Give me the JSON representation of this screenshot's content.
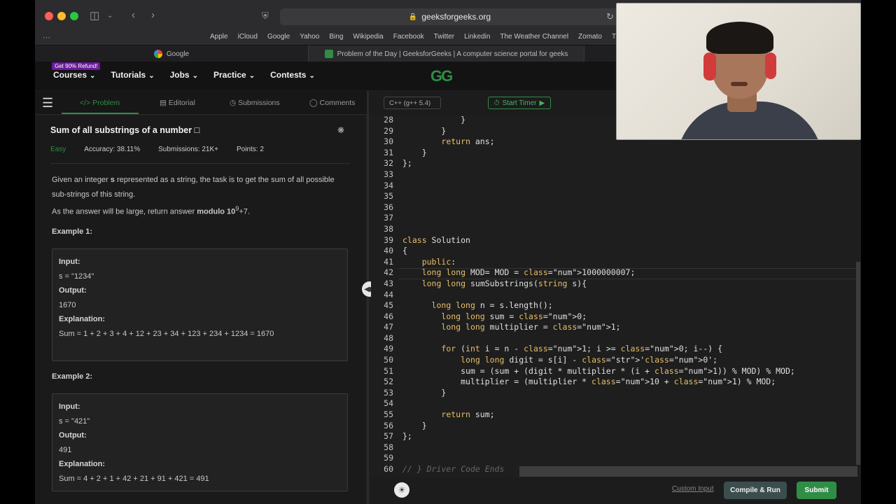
{
  "browser": {
    "url": "geeksforgeeks.org",
    "bookmarks": [
      "Apple",
      "iCloud",
      "Google",
      "Yahoo",
      "Bing",
      "Wikipedia",
      "Facebook",
      "Twitter",
      "Linkedin",
      "The Weather Channel",
      "Zomato",
      "TripAdvi"
    ],
    "tabs": [
      {
        "label": "Google"
      },
      {
        "label": "Problem of the Day | GeeksforGeeks | A computer science portal for geeks"
      }
    ]
  },
  "nav": {
    "badge": "Get 90% Refund!",
    "items": [
      "Courses",
      "Tutorials",
      "Jobs",
      "Practice",
      "Contests"
    ],
    "logo": "GG"
  },
  "problem_tabs": {
    "problem": "Problem",
    "editorial": "Editorial",
    "submissions": "Submissions",
    "comments": "Comments"
  },
  "problem": {
    "title": "Sum of all substrings of a number",
    "difficulty": "Easy",
    "accuracy": "Accuracy: 38.11%",
    "submissions": "Submissions: 21K+",
    "points": "Points: 2",
    "desc_a": "Given an integer ",
    "desc_var": "s",
    "desc_b": " represented as a string, the task is to get the sum of all possible sub-strings of this string.",
    "desc2_a": "As the answer will be large, return answer ",
    "desc2_bold": "modulo 10",
    "desc2_sup": "9",
    "desc2_b": "+7."
  },
  "examples": [
    {
      "title": "Example 1:",
      "input_label": "Input:",
      "input": "s = \"1234\"",
      "output_label": "Output:",
      "output": "1670",
      "explanation_label": "Explanation:",
      "explanation": "Sum = 1 + 2 + 3 + 4 + 12 + 23 + 34 + 123 + 234 + 1234 = 1670"
    },
    {
      "title": "Example 2:",
      "input_label": "Input:",
      "input": "s = \"421\"",
      "output_label": "Output:",
      "output": "491",
      "explanation_label": "Explanation:",
      "explanation": "Sum = 4 + 2 + 1 + 42 + 21 + 91 + 421 = 491"
    }
  ],
  "editor": {
    "language": "C++ (g++ 5.4)",
    "timer": "Start Timer",
    "lines": [
      {
        "n": "28",
        "t": "            }"
      },
      {
        "n": "29",
        "t": "        }"
      },
      {
        "n": "30",
        "t": "        return ans;"
      },
      {
        "n": "31",
        "t": "    }"
      },
      {
        "n": "32",
        "t": "};"
      },
      {
        "n": "33",
        "t": ""
      },
      {
        "n": "34",
        "t": ""
      },
      {
        "n": "35",
        "t": ""
      },
      {
        "n": "36",
        "t": ""
      },
      {
        "n": "37",
        "t": ""
      },
      {
        "n": "38",
        "t": ""
      },
      {
        "n": "39",
        "t": "class Solution"
      },
      {
        "n": "40",
        "t": "{"
      },
      {
        "n": "41",
        "t": "    public:"
      },
      {
        "n": "42",
        "t": "    long long MOD= MOD = 1000000007;"
      },
      {
        "n": "43",
        "t": "    long long sumSubstrings(string s){"
      },
      {
        "n": "44",
        "t": ""
      },
      {
        "n": "45",
        "t": "      long long n = s.length();"
      },
      {
        "n": "46",
        "t": "        long long sum = 0;"
      },
      {
        "n": "47",
        "t": "        long long multiplier = 1;"
      },
      {
        "n": "48",
        "t": ""
      },
      {
        "n": "49",
        "t": "        for (int i = n - 1; i >= 0; i--) {"
      },
      {
        "n": "50",
        "t": "            long long digit = s[i] - '0';"
      },
      {
        "n": "51",
        "t": "            sum = (sum + (digit * multiplier * (i + 1)) % MOD) % MOD;"
      },
      {
        "n": "52",
        "t": "            multiplier = (multiplier * 10 + 1) % MOD;"
      },
      {
        "n": "53",
        "t": "        }"
      },
      {
        "n": "54",
        "t": ""
      },
      {
        "n": "55",
        "t": "        return sum;"
      },
      {
        "n": "56",
        "t": "    }"
      },
      {
        "n": "57",
        "t": "};"
      },
      {
        "n": "58",
        "t": ""
      },
      {
        "n": "59",
        "t": ""
      },
      {
        "n": "60",
        "t": "// } Driver Code Ends"
      }
    ]
  },
  "footer": {
    "custom_input": "Custom Input",
    "compile_run": "Compile & Run",
    "submit": "Submit"
  }
}
